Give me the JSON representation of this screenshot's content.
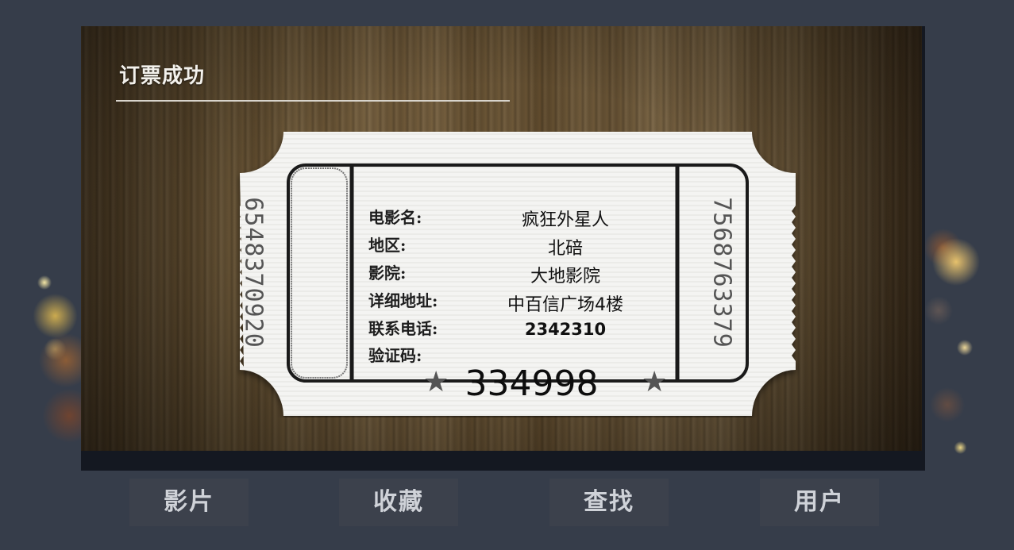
{
  "panel": {
    "title": "订票成功"
  },
  "ticket": {
    "stub_left_number": "6548370920",
    "stub_right_number": "7568763379",
    "labels": {
      "movie": "电影名:",
      "region": "地区:",
      "cinema": "影院:",
      "address": "详细地址:",
      "phone": "联系电话:",
      "code": "验证码:"
    },
    "values": {
      "movie": "疯狂外星人",
      "region": "北碚",
      "cinema": "大地影院",
      "address": "中百信广场4楼",
      "phone": "2342310",
      "code": "334998"
    },
    "icons": {
      "star_left": "star-icon",
      "star_right": "star-icon"
    }
  },
  "nav": [
    {
      "label": "影片"
    },
    {
      "label": "收藏"
    },
    {
      "label": "查找"
    },
    {
      "label": "用户"
    }
  ],
  "colors": {
    "background": "#363d4a",
    "panel_frame": "#141821",
    "nav_button": "#3c414c",
    "ticket_paper": "#f4f4f2"
  }
}
